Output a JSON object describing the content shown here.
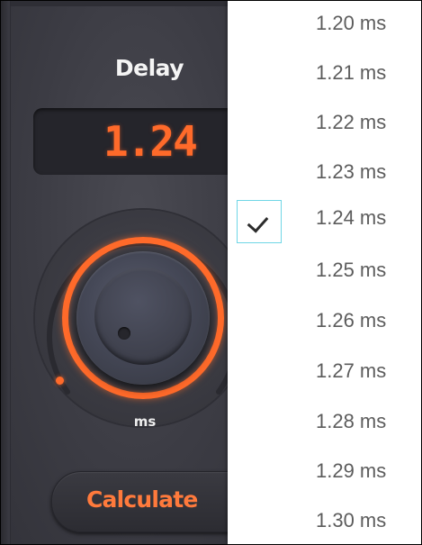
{
  "plugin": {
    "parameter_title": "Delay",
    "readout_value": "1.24",
    "unit": "ms",
    "calculate_label": "Calculate",
    "accent_color": "#ff6a2a"
  },
  "dropdown": {
    "selected_index": 4,
    "options": [
      {
        "label": "1.20 ms"
      },
      {
        "label": "1.21 ms"
      },
      {
        "label": "1.22 ms"
      },
      {
        "label": "1.23 ms"
      },
      {
        "label": "1.24 ms"
      },
      {
        "label": "1.25 ms"
      },
      {
        "label": "1.26 ms"
      },
      {
        "label": "1.27 ms"
      },
      {
        "label": "1.28 ms"
      },
      {
        "label": "1.29 ms"
      },
      {
        "label": "1.30 ms"
      }
    ],
    "focus_color": "#6fd6e6",
    "checkmark_icon": "checkmark-icon"
  }
}
